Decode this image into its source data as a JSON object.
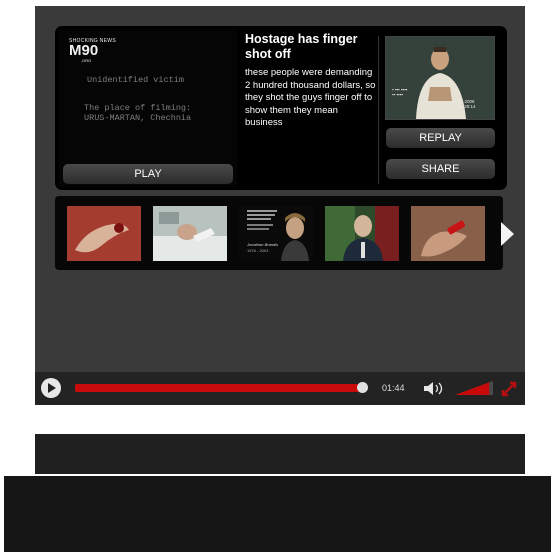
{
  "player": {
    "logo": {
      "top": "SHOCKING NEWS",
      "main": "M90",
      "sub": ".ORG"
    },
    "frame_text": {
      "line1": "Unidentified victim",
      "line2": "The place of filming:",
      "line3": "URUS-MARTAN, Chechnia"
    },
    "play_label": "PLAY",
    "title": "Hostage has finger shot off",
    "description": "these people were demanding 2 hundred thousand dollars, so they shot the guys finger off to show them they mean business",
    "replay_label": "REPLAY",
    "share_label": "SHARE",
    "thumb_overlay": {
      "date": "21.12.2006",
      "time": "10:29:14"
    },
    "related_thumbs": [
      "finger-wound",
      "hospital-bed",
      "missing-poster",
      "man-in-suit",
      "bloody-hand"
    ],
    "poster_text": {
      "line1": "Jonathan Brandis",
      "line2": "1976 - 2003"
    },
    "next_icon": "next-arrow-icon"
  },
  "controls": {
    "time": "01:44",
    "progress": 0.99,
    "volume": 0.9,
    "accent_color": "#c80a0a"
  }
}
